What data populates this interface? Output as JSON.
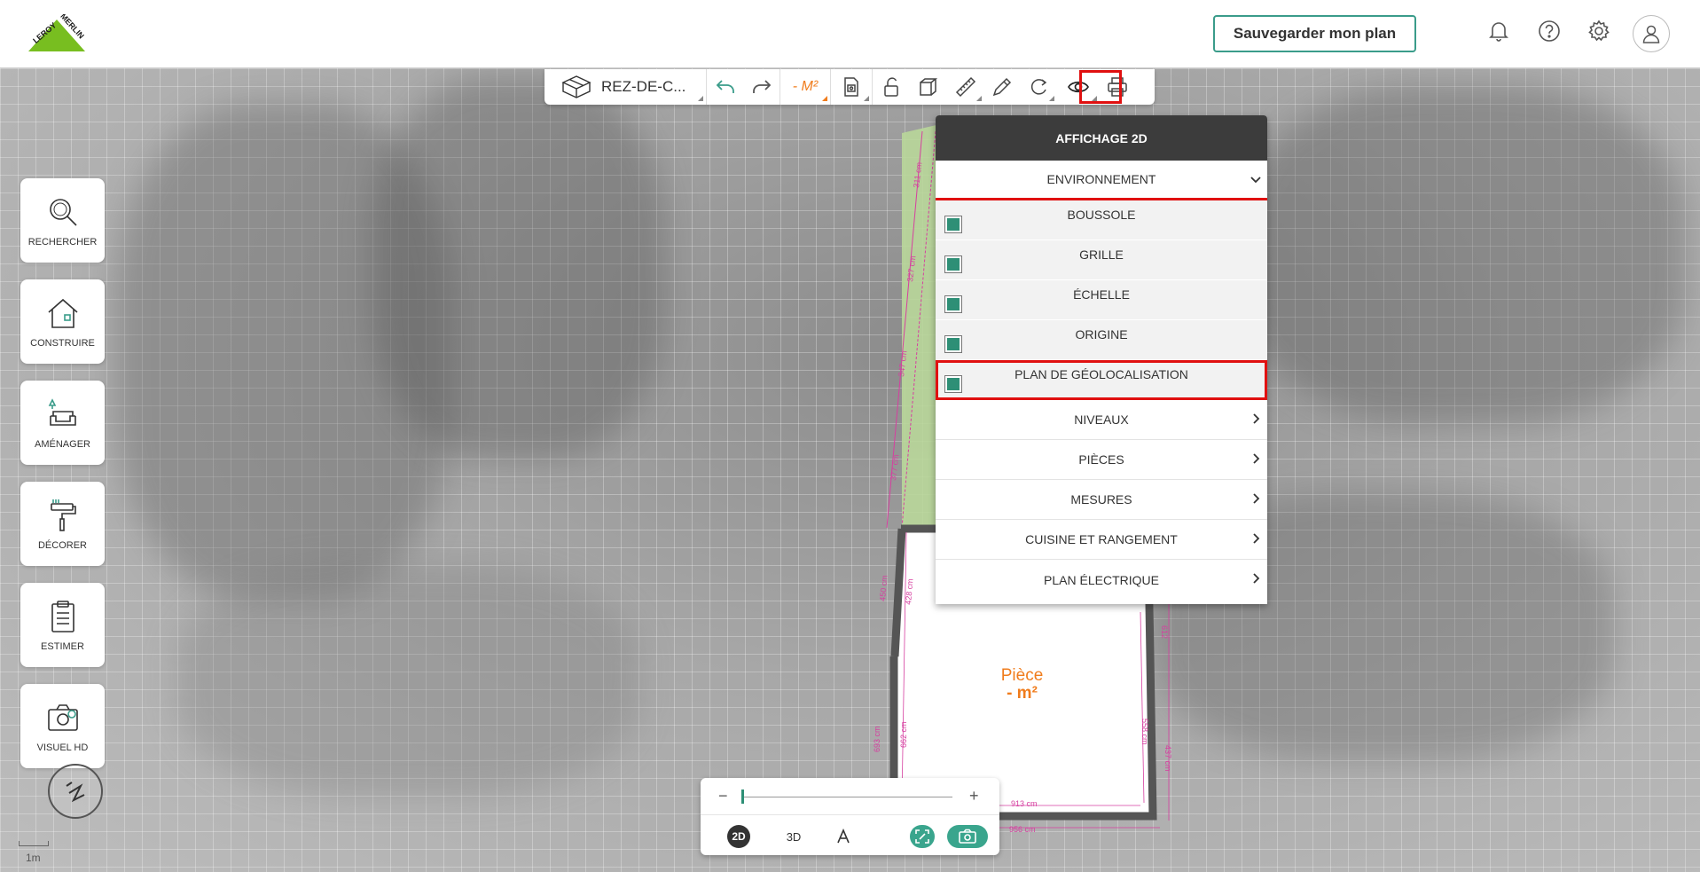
{
  "header": {
    "logo_text": "LEROY MERLIN",
    "save_button": "Sauvegarder mon plan",
    "icons": [
      "bell-icon",
      "help-icon",
      "gear-icon",
      "user-icon"
    ]
  },
  "toolbar": {
    "level": "REZ-DE-C...",
    "area": "- M²",
    "icons": [
      "level-cube-icon",
      "undo-icon",
      "redo-icon",
      "area-icon",
      "floorplan-import-icon",
      "lock-icon",
      "3d-box-icon",
      "ruler-icon",
      "pencil-icon",
      "magnet-icon",
      "eye-icon",
      "print-icon"
    ]
  },
  "panel": {
    "title": "AFFICHAGE 2D",
    "environment": {
      "label": "ENVIRONNEMENT",
      "items": [
        {
          "label": "BOUSSOLE",
          "checked": true
        },
        {
          "label": "GRILLE",
          "checked": true
        },
        {
          "label": "ÉCHELLE",
          "checked": true
        },
        {
          "label": "ORIGINE",
          "checked": true
        },
        {
          "label": "PLAN DE GÉOLOCALISATION",
          "checked": true
        }
      ]
    },
    "sections": [
      "NIVEAUX",
      "PIÈCES",
      "MESURES",
      "CUISINE ET RANGEMENT",
      "PLAN ÉLECTRIQUE"
    ]
  },
  "sidebar": {
    "items": [
      {
        "label": "RECHERCHER",
        "icon": "search-icon"
      },
      {
        "label": "CONSTRUIRE",
        "icon": "house-icon"
      },
      {
        "label": "AMÉNAGER",
        "icon": "sofa-icon"
      },
      {
        "label": "DÉCORER",
        "icon": "paint-roller-icon"
      },
      {
        "label": "ESTIMER",
        "icon": "clipboard-icon"
      },
      {
        "label": "VISUEL HD",
        "icon": "camera-icon"
      }
    ]
  },
  "room": {
    "name": "Pièce",
    "area": "- m²"
  },
  "measurements": [
    "311 cm",
    "327 cm",
    "347 cm",
    "377 cm",
    "450 cm",
    "428 cm",
    "693 cm",
    "662 cm",
    "612",
    "558 cm",
    "437 cm",
    "913 cm",
    "956 cm"
  ],
  "scale": {
    "label": "1m"
  },
  "zoom": {
    "minus": "−",
    "plus": "+",
    "level": 0.0
  },
  "views": {
    "view_2d": "2D",
    "view_3d": "3D",
    "active": "2D"
  },
  "colors": {
    "accent": "#2e8f76",
    "brand_green": "#3aa58d",
    "highlight": "#e01010",
    "orange": "#f07c1c",
    "measure": "#d63fa0"
  }
}
